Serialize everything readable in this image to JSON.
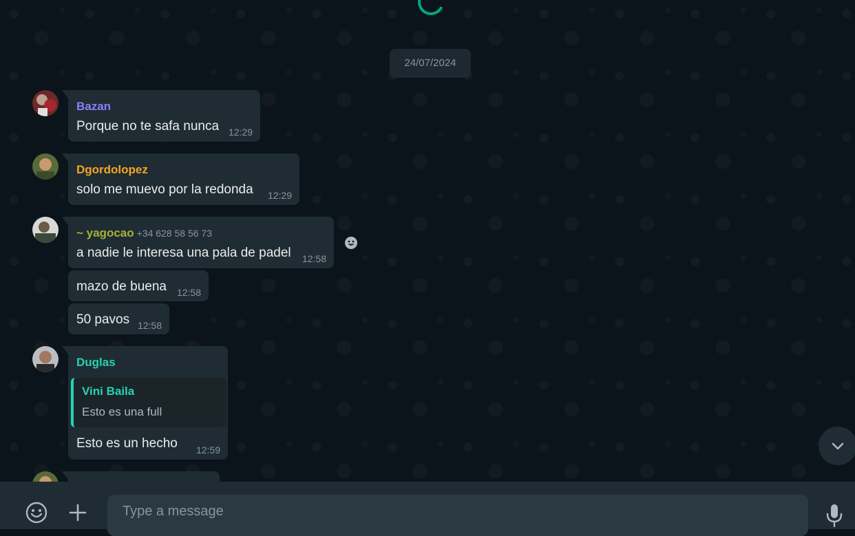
{
  "chat": {
    "date_chip": "24/07/2024",
    "messages": [
      {
        "sender": "Bazan",
        "sender_color": "#8b7dff",
        "text": "Porque no te safa nunca",
        "time": "12:29"
      },
      {
        "sender": "Dgordolopez",
        "sender_color": "#f5a623",
        "text": "solo me muevo por la redonda",
        "time": "12:29"
      },
      {
        "sender": "~ yagocao",
        "sender_color": "#a5b337",
        "phone": "+34 628 58 56 73",
        "text": "a nadie le interesa una pala de padel",
        "time": "12:58"
      },
      {
        "text": "mazo de buena",
        "time": "12:58"
      },
      {
        "text": "50 pavos",
        "time": "12:58"
      },
      {
        "sender": "Duglas",
        "sender_color": "#25d3b1",
        "quote": {
          "author": "Vini Baila",
          "text": "Esto es una full"
        },
        "text": "Esto es un hecho",
        "time": "12:59"
      }
    ]
  },
  "composer": {
    "placeholder": "Type a message"
  },
  "icons": {
    "react": "emoji-react-icon",
    "scroll_down": "chevron-down-icon",
    "emoji": "emoji-icon",
    "attach": "plus-icon",
    "mic": "microphone-icon"
  },
  "colors": {
    "background": "#0b141a",
    "bubble": "#202c33",
    "accent": "#00a884"
  }
}
